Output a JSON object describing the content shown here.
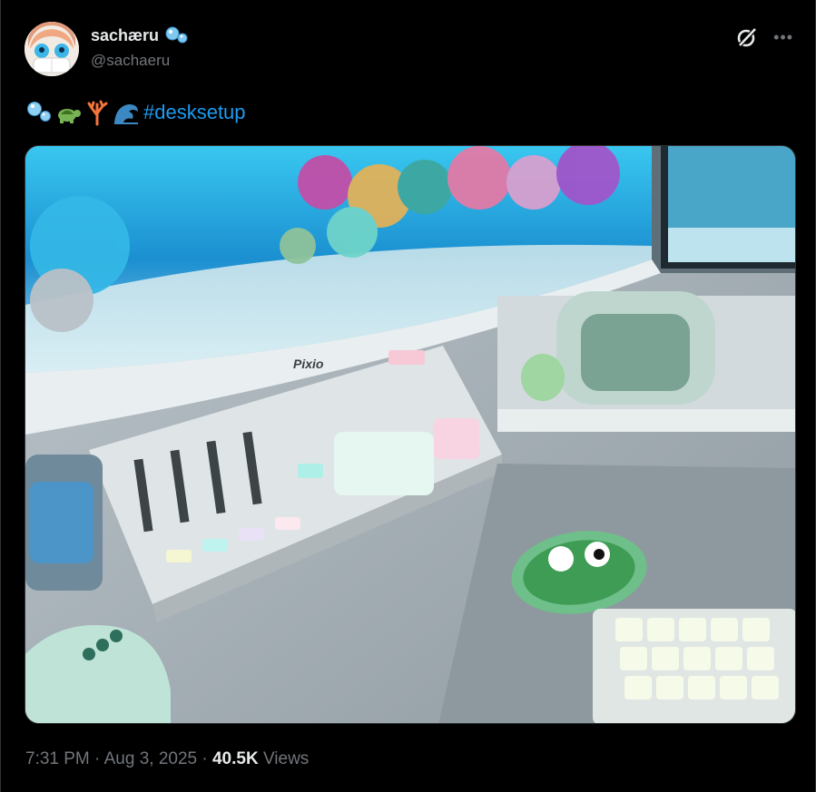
{
  "user": {
    "display_name": "sachæru",
    "handle": "@sachaeru"
  },
  "tweet": {
    "emojis": [
      "bubbles-emoji",
      "turtle-emoji",
      "coral-emoji",
      "wave-emoji"
    ],
    "hashtag": "#desksetup",
    "photo_label": "Pixio"
  },
  "meta": {
    "time": "7:31 PM",
    "sep1": "·",
    "date": "Aug 3, 2025",
    "sep2": "·",
    "views_count": "40.5K",
    "views_label": "Views"
  },
  "icons": {
    "grok": "grok-icon",
    "more": "more-icon",
    "verified_badge": "bubbles-emoji"
  },
  "colors": {
    "background": "#000000",
    "text": "#e7e9ea",
    "secondary": "#71767b",
    "link": "#1d9bf0",
    "border": "#2f3336"
  }
}
